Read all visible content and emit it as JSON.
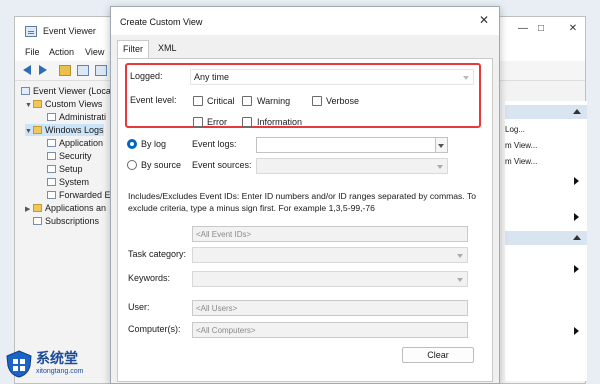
{
  "background_window": {
    "title": "Event Viewer",
    "menu": [
      "File",
      "Action",
      "View"
    ],
    "tree": [
      {
        "label": "Event Viewer (Local)",
        "indent": 0,
        "expander": "",
        "icon": "app"
      },
      {
        "label": "Custom Views",
        "indent": 1,
        "expander": "⌄",
        "icon": "folder"
      },
      {
        "label": "Administrati",
        "indent": 2,
        "expander": "",
        "icon": "log"
      },
      {
        "label": "Windows Logs",
        "indent": 1,
        "expander": "⌄",
        "icon": "folder"
      },
      {
        "label": "Application",
        "indent": 2,
        "expander": "",
        "icon": "log"
      },
      {
        "label": "Security",
        "indent": 2,
        "expander": "",
        "icon": "log"
      },
      {
        "label": "Setup",
        "indent": 2,
        "expander": "",
        "icon": "log"
      },
      {
        "label": "System",
        "indent": 2,
        "expander": "",
        "icon": "log"
      },
      {
        "label": "Forwarded E",
        "indent": 2,
        "expander": "",
        "icon": "log"
      },
      {
        "label": "Applications an",
        "indent": 1,
        "expander": "›",
        "icon": "folder"
      },
      {
        "label": "Subscriptions",
        "indent": 1,
        "expander": "",
        "icon": "log"
      }
    ],
    "actions": [
      "Log...",
      "m View...",
      "m View..."
    ]
  },
  "dialog": {
    "title": "Create Custom View",
    "close_glyph": "✕",
    "tabs": [
      "Filter",
      "XML"
    ],
    "active_tab": "Filter",
    "logged_label": "Logged:",
    "logged_value": "Any time",
    "event_level_label": "Event level:",
    "levels": [
      {
        "label": "Critical",
        "checked": false
      },
      {
        "label": "Warning",
        "checked": false
      },
      {
        "label": "Verbose",
        "checked": false
      },
      {
        "label": "Error",
        "checked": false
      },
      {
        "label": "Information",
        "checked": false
      }
    ],
    "by_log_label": "By log",
    "by_source_label": "By source",
    "selected_mode": "By log",
    "event_logs_label": "Event logs:",
    "event_logs_value": "",
    "event_sources_label": "Event sources:",
    "event_sources_value": "",
    "info_text": "Includes/Excludes Event IDs: Enter ID numbers and/or ID ranges separated by commas. To exclude criteria, type a minus sign first. For example 1,3,5-99,-76",
    "event_ids_placeholder": "<All Event IDs>",
    "task_category_label": "Task category:",
    "keywords_label": "Keywords:",
    "user_label": "User:",
    "user_placeholder": "<All Users>",
    "computers_label": "Computer(s):",
    "computers_placeholder": "<All Computers>",
    "clear_button": "Clear",
    "highlight_color": "#e53940",
    "accent_color": "#0067c0"
  },
  "watermark": {
    "text": "系统堂",
    "url": "xitongtang.com"
  }
}
